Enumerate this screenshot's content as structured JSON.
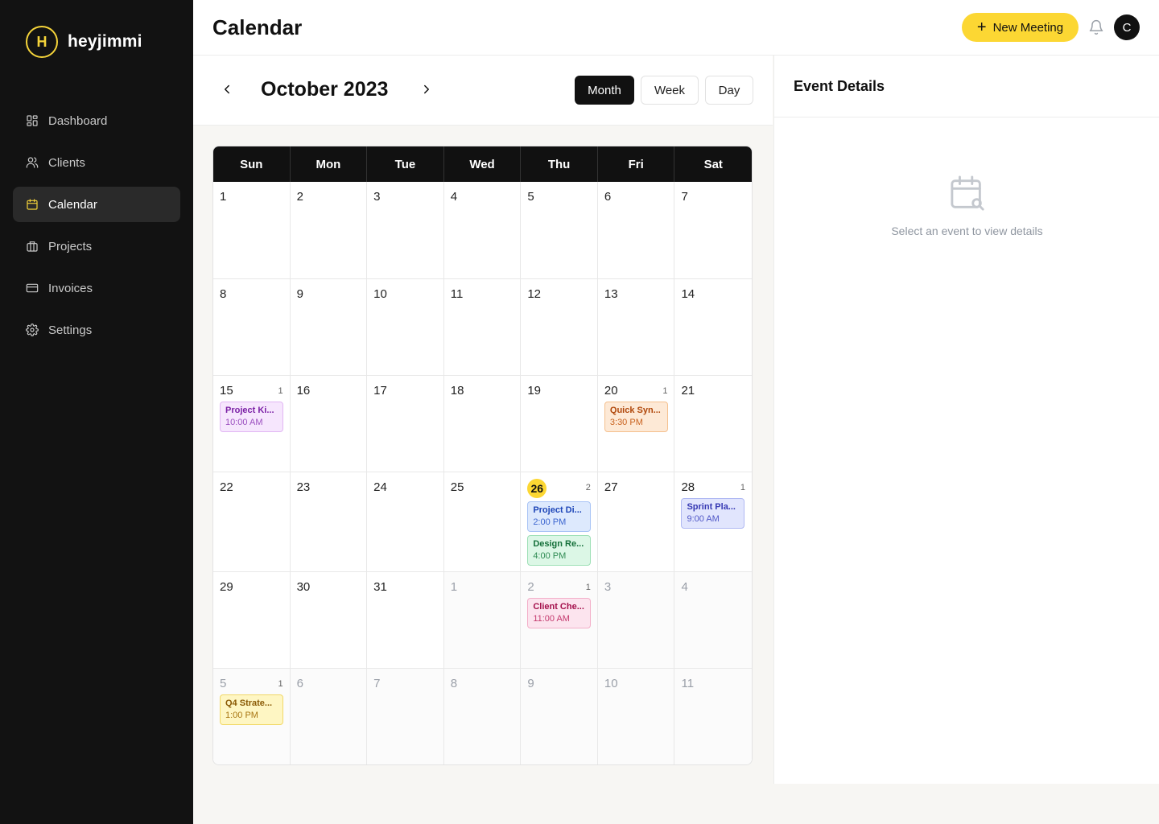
{
  "brand": {
    "logo_letter": "H",
    "name": "heyjimmi"
  },
  "sidebar": {
    "items": [
      {
        "label": "Dashboard",
        "icon": "dashboard-icon",
        "active": false
      },
      {
        "label": "Clients",
        "icon": "users-icon",
        "active": false
      },
      {
        "label": "Calendar",
        "icon": "calendar-icon",
        "active": true
      },
      {
        "label": "Projects",
        "icon": "briefcase-icon",
        "active": false
      },
      {
        "label": "Invoices",
        "icon": "credit-card-icon",
        "active": false
      },
      {
        "label": "Settings",
        "icon": "gear-icon",
        "active": false
      }
    ]
  },
  "header": {
    "title": "Calendar",
    "new_meeting_label": "New Meeting",
    "avatar_initial": "C"
  },
  "calendar": {
    "month_label": "October 2023",
    "views": [
      {
        "label": "Month",
        "active": true
      },
      {
        "label": "Week",
        "active": false
      },
      {
        "label": "Day",
        "active": false
      }
    ],
    "weekdays": [
      "Sun",
      "Mon",
      "Tue",
      "Wed",
      "Thu",
      "Fri",
      "Sat"
    ],
    "weeks": [
      [
        {
          "d": "1"
        },
        {
          "d": "2"
        },
        {
          "d": "3"
        },
        {
          "d": "4"
        },
        {
          "d": "5"
        },
        {
          "d": "6"
        },
        {
          "d": "7"
        }
      ],
      [
        {
          "d": "8"
        },
        {
          "d": "9"
        },
        {
          "d": "10"
        },
        {
          "d": "11"
        },
        {
          "d": "12"
        },
        {
          "d": "13"
        },
        {
          "d": "14"
        }
      ],
      [
        {
          "d": "15",
          "count": "1",
          "events": [
            {
              "title": "Project Ki...",
              "time": "10:00 AM",
              "color": "purple"
            }
          ]
        },
        {
          "d": "16"
        },
        {
          "d": "17"
        },
        {
          "d": "18"
        },
        {
          "d": "19"
        },
        {
          "d": "20",
          "count": "1",
          "events": [
            {
              "title": "Quick Syn...",
              "time": "3:30 PM",
              "color": "orange"
            }
          ]
        },
        {
          "d": "21"
        }
      ],
      [
        {
          "d": "22"
        },
        {
          "d": "23"
        },
        {
          "d": "24"
        },
        {
          "d": "25"
        },
        {
          "d": "26",
          "today": true,
          "count": "2",
          "events": [
            {
              "title": "Project Di...",
              "time": "2:00 PM",
              "color": "blue"
            },
            {
              "title": "Design Re...",
              "time": "4:00 PM",
              "color": "green"
            }
          ]
        },
        {
          "d": "27"
        },
        {
          "d": "28",
          "count": "1",
          "events": [
            {
              "title": "Sprint Pla...",
              "time": "9:00 AM",
              "color": "indigo"
            }
          ]
        }
      ],
      [
        {
          "d": "29"
        },
        {
          "d": "30"
        },
        {
          "d": "31"
        },
        {
          "d": "1",
          "out": true
        },
        {
          "d": "2",
          "out": true,
          "count": "1",
          "events": [
            {
              "title": "Client Che...",
              "time": "11:00 AM",
              "color": "pink"
            }
          ]
        },
        {
          "d": "3",
          "out": true
        },
        {
          "d": "4",
          "out": true
        }
      ],
      [
        {
          "d": "5",
          "out": true,
          "count": "1",
          "events": [
            {
              "title": "Q4 Strate...",
              "time": "1:00 PM",
              "color": "yellow"
            }
          ]
        },
        {
          "d": "6",
          "out": true
        },
        {
          "d": "7",
          "out": true
        },
        {
          "d": "8",
          "out": true
        },
        {
          "d": "9",
          "out": true
        },
        {
          "d": "10",
          "out": true
        },
        {
          "d": "11",
          "out": true
        }
      ]
    ]
  },
  "details": {
    "title": "Event Details",
    "empty_icon": "calendar-search-icon",
    "empty_text": "Select an event to view details"
  },
  "colors": {
    "accent": "#fcd733",
    "sidebar_bg": "#121212",
    "events": {
      "purple": {
        "bg": "#f6e6fd",
        "border": "#e1b6f3",
        "title": "#7a1fa5",
        "time": "#9b4fc0"
      },
      "orange": {
        "bg": "#fde9d6",
        "border": "#f5c08e",
        "title": "#b0470a",
        "time": "#c9621f"
      },
      "blue": {
        "bg": "#dde9fd",
        "border": "#a9c4f5",
        "title": "#1e46b8",
        "time": "#3a64cf"
      },
      "green": {
        "bg": "#dcf7e6",
        "border": "#9ee0b6",
        "title": "#15703a",
        "time": "#2f8b53"
      },
      "indigo": {
        "bg": "#e1e5fd",
        "border": "#b0b9f3",
        "title": "#3538b3",
        "time": "#5057c7"
      },
      "pink": {
        "bg": "#fce4ee",
        "border": "#f3afc9",
        "title": "#a4104c",
        "time": "#c43a6e"
      },
      "yellow": {
        "bg": "#fef6c3",
        "border": "#f1d867",
        "title": "#8a5a05",
        "time": "#a87512"
      }
    }
  }
}
